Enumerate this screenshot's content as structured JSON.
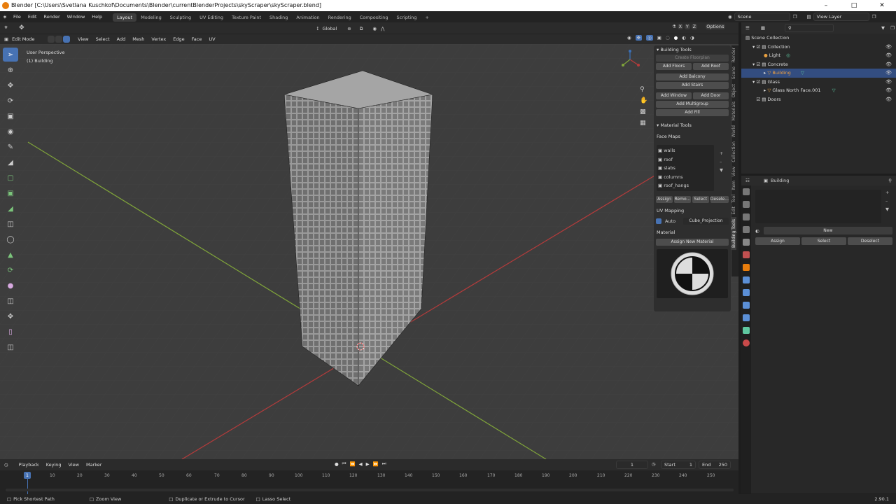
{
  "window": {
    "title": "Blender [C:\\Users\\Svetlana Kuschkof\\Documents\\Blender\\currentBlenderProjects\\skyScraper\\skyScraper.blend]"
  },
  "menu": [
    "File",
    "Edit",
    "Render",
    "Window",
    "Help"
  ],
  "workspaces": [
    "Layout",
    "Modeling",
    "Sculpting",
    "UV Editing",
    "Texture Paint",
    "Shading",
    "Animation",
    "Rendering",
    "Compositing",
    "Scripting"
  ],
  "active_workspace": "Layout",
  "scene": {
    "label": "Scene",
    "view_layer": "View Layer"
  },
  "viewport_header": {
    "transform_orientation": "Global",
    "options": "Options",
    "mode": "Edit Mode",
    "menus": [
      "View",
      "Select",
      "Add",
      "Mesh",
      "Vertex",
      "Edge",
      "Face",
      "UV"
    ],
    "view_name": "User Perspective",
    "object_label": "(1) Building"
  },
  "colors": {
    "accent": "#4772b3",
    "selected_row": "#334d80",
    "x_axis": "#b53b3b",
    "y_axis": "#7fa33a",
    "orange": "#e87d0d"
  },
  "npanel": {
    "building_tools": "Building Tools",
    "create_floorplan": "Create Floorplan",
    "add_floors": "Add Floors",
    "add_roof": "Add Roof",
    "add_balcony": "Add Balcony",
    "add_stairs": "Add Stairs",
    "add_window": "Add Window",
    "add_door": "Add Door",
    "add_multigroup": "Add Multigroup",
    "add_fill": "Add Fill",
    "material_tools": "Material Tools",
    "face_maps": "Face Maps",
    "face_map_items": [
      "walls",
      "roof",
      "slabs",
      "columns",
      "roof_hangs"
    ],
    "assign": "Assign",
    "remove": "Remo...",
    "select": "Select",
    "deselect": "Desele...",
    "uv_mapping": "UV Mapping",
    "auto": "Auto",
    "projection": "Cube_Projection",
    "material": "Material",
    "assign_new_material": "Assign New Material",
    "tabs": [
      "Render",
      "Scene",
      "Object",
      "Materials",
      "World",
      "Collection",
      "View",
      "Item",
      "Tool",
      "Edit",
      "Building Tools"
    ]
  },
  "outliner": {
    "root": "Scene Collection",
    "items": [
      {
        "label": "Collection",
        "indent": 1,
        "selected": false
      },
      {
        "label": "Light",
        "indent": 2,
        "selected": false
      },
      {
        "label": "Concrete",
        "indent": 1,
        "selected": false
      },
      {
        "label": "Building",
        "indent": 2,
        "selected": true
      },
      {
        "label": "Glass",
        "indent": 1,
        "selected": false
      },
      {
        "label": "Glass North Face.001",
        "indent": 2,
        "selected": false
      },
      {
        "label": "Doors",
        "indent": 1,
        "selected": false
      }
    ]
  },
  "properties": {
    "object": "Building",
    "new": "New",
    "assign": "Assign",
    "select": "Select",
    "deselect": "Deselect"
  },
  "timeline": {
    "menus": [
      "Playback",
      "Keying",
      "View",
      "Marker"
    ],
    "current_frame": "1",
    "start_label": "Start",
    "start": "1",
    "end_label": "End",
    "end": "250",
    "ticks": [
      "10",
      "20",
      "30",
      "40",
      "50",
      "60",
      "70",
      "80",
      "90",
      "100",
      "110",
      "120",
      "130",
      "140",
      "150",
      "160",
      "170",
      "180",
      "190",
      "200",
      "210",
      "220",
      "230",
      "240",
      "250"
    ]
  },
  "status": {
    "items": [
      "Pick Shortest Path",
      "Zoom View",
      "Duplicate or Extrude to Cursor",
      "Lasso Select"
    ],
    "version": "2.90.1"
  }
}
